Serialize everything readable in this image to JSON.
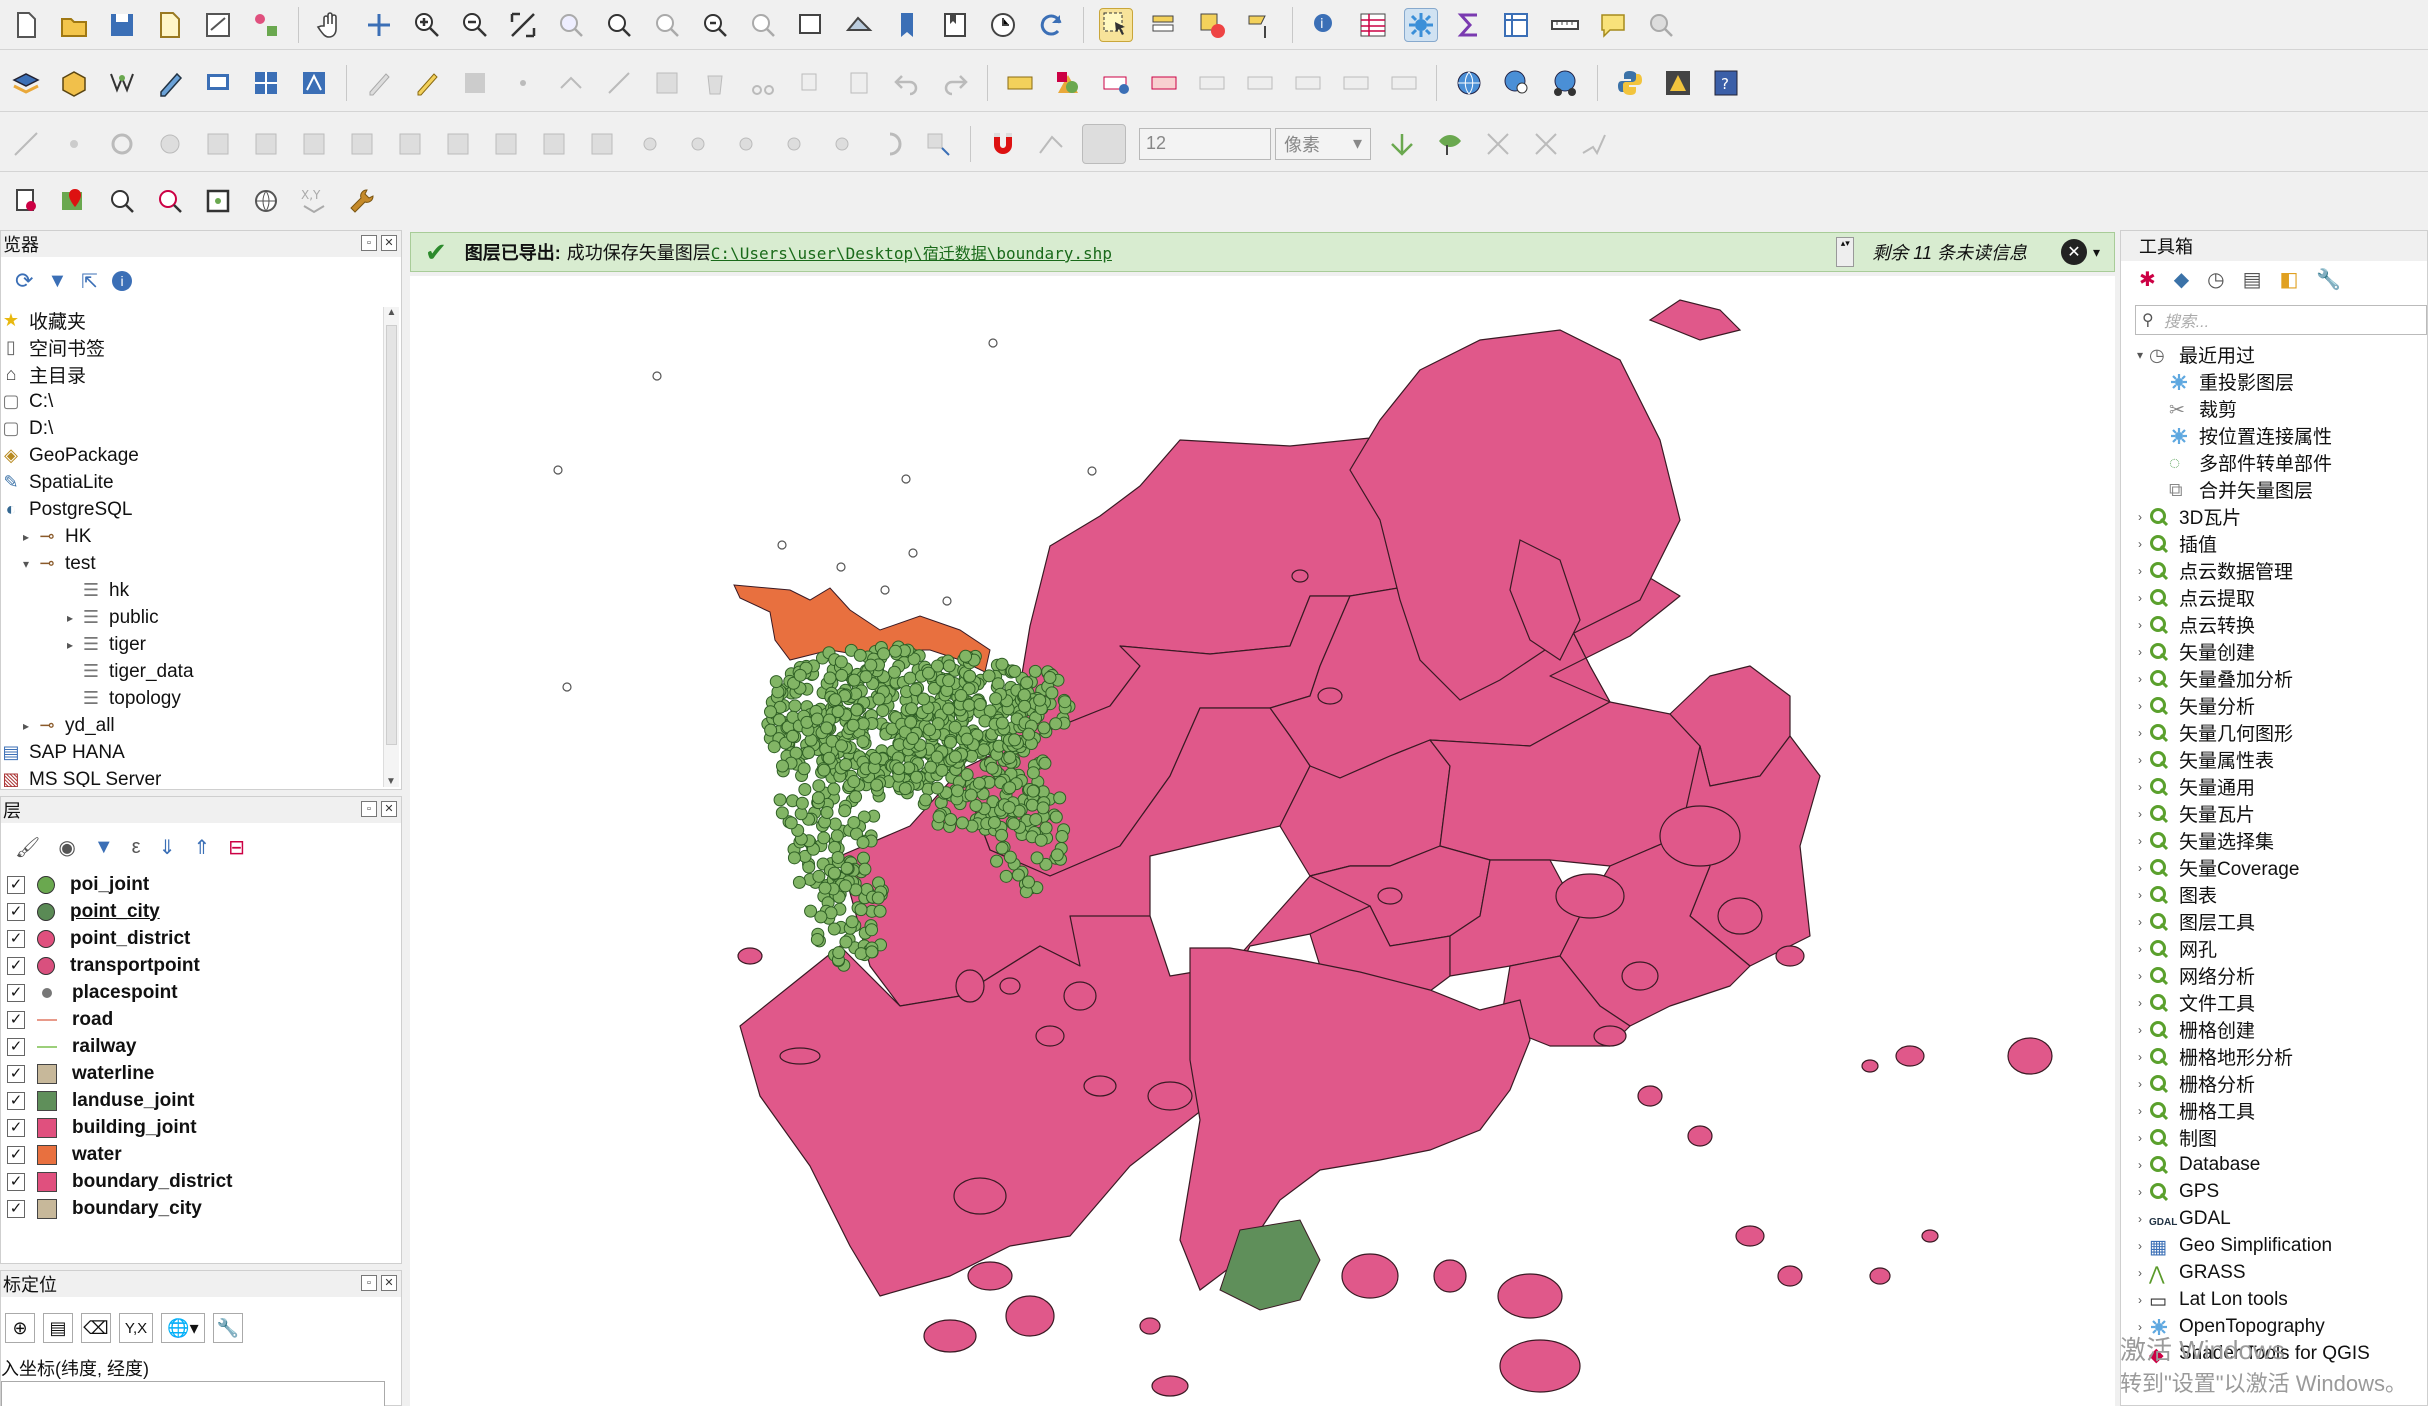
{
  "toolbars": {
    "font_size_value": "12",
    "unit_select": "像素"
  },
  "browser": {
    "title": "览器",
    "items": [
      {
        "label": "收藏夹",
        "icon": "star-icon",
        "indent": 0
      },
      {
        "label": "空间书签",
        "icon": "bookmark-icon",
        "indent": 0
      },
      {
        "label": "主目录",
        "icon": "home-folder-icon",
        "indent": 0
      },
      {
        "label": "C:\\",
        "icon": "folder-icon",
        "indent": 0
      },
      {
        "label": "D:\\",
        "icon": "folder-icon",
        "indent": 0
      },
      {
        "label": "GeoPackage",
        "icon": "geopackage-icon",
        "indent": 0
      },
      {
        "label": "SpatiaLite",
        "icon": "spatialite-icon",
        "indent": 0
      },
      {
        "label": "PostgreSQL",
        "icon": "postgresql-icon",
        "indent": 0
      },
      {
        "label": "HK",
        "icon": "connection-icon",
        "indent": 1,
        "expander": "▸"
      },
      {
        "label": "test",
        "icon": "connection-icon",
        "indent": 1,
        "expander": "▾"
      },
      {
        "label": "hk",
        "icon": "schema-icon",
        "indent": 3
      },
      {
        "label": "public",
        "icon": "schema-icon",
        "indent": 3,
        "expander": "▸"
      },
      {
        "label": "tiger",
        "icon": "schema-icon",
        "indent": 3,
        "expander": "▸"
      },
      {
        "label": "tiger_data",
        "icon": "schema-icon",
        "indent": 3
      },
      {
        "label": "topology",
        "icon": "schema-icon",
        "indent": 3
      },
      {
        "label": "yd_all",
        "icon": "connection-icon",
        "indent": 1,
        "expander": "▸"
      },
      {
        "label": "SAP HANA",
        "icon": "hana-icon",
        "indent": 0
      },
      {
        "label": "MS SQL Server",
        "icon": "mssql-icon",
        "indent": 0
      }
    ]
  },
  "layers": {
    "title": "层",
    "items": [
      {
        "label": "poi_joint",
        "symbol": "point",
        "color": "#6aa84f"
      },
      {
        "label": "point_city",
        "symbol": "point",
        "color": "#5a8a55",
        "underline": true
      },
      {
        "label": "point_district",
        "symbol": "point",
        "color": "#e0507e"
      },
      {
        "label": "transportpoint",
        "symbol": "point",
        "color": "#d9507e"
      },
      {
        "label": "placespoint",
        "symbol": "dot",
        "color": "#777777"
      },
      {
        "label": "road",
        "symbol": "line",
        "color": "#e89a8a"
      },
      {
        "label": "railway",
        "symbol": "line",
        "color": "#9ccf7a"
      },
      {
        "label": "waterline",
        "symbol": "fill",
        "color": "#c7b89a"
      },
      {
        "label": "landuse_joint",
        "symbol": "fill",
        "color": "#5f8f5a"
      },
      {
        "label": "building_joint",
        "symbol": "fill",
        "color": "#e0507e"
      },
      {
        "label": "water",
        "symbol": "fill",
        "color": "#e8703f"
      },
      {
        "label": "boundary_district",
        "symbol": "fill",
        "color": "#e0507e"
      },
      {
        "label": "boundary_city",
        "symbol": "fill",
        "color": "#c7b89a"
      }
    ]
  },
  "locator": {
    "title": "标定位",
    "yx_button": "Y,X",
    "prompt": "入坐标(纬度, 经度)"
  },
  "message_bar": {
    "title": "图层已导出:",
    "text": "成功保存矢量图层",
    "link": "C:\\Users\\user\\Desktop\\宿迁数据\\boundary.shp",
    "remaining": "剩余 11 条未读信息"
  },
  "toolbox": {
    "title": "工具箱",
    "search_placeholder": "搜索...",
    "recent_label": "最近用过",
    "recent": [
      {
        "label": "重投影图层",
        "icon": "gear-icon"
      },
      {
        "label": "裁剪",
        "icon": "clip-icon"
      },
      {
        "label": "按位置连接属性",
        "icon": "gear-icon"
      },
      {
        "label": "多部件转单部件",
        "icon": "multipart-icon"
      },
      {
        "label": "合并矢量图层",
        "icon": "merge-icon"
      }
    ],
    "groups": [
      "3D瓦片",
      "插值",
      "点云数据管理",
      "点云提取",
      "点云转换",
      "矢量创建",
      "矢量叠加分析",
      "矢量分析",
      "矢量几何图形",
      "矢量属性表",
      "矢量通用",
      "矢量瓦片",
      "矢量选择集",
      "矢量Coverage",
      "图表",
      "图层工具",
      "网孔",
      "网络分析",
      "文件工具",
      "栅格创建",
      "栅格地形分析",
      "栅格分析",
      "栅格工具",
      "制图",
      "Database",
      "GPS"
    ],
    "providers": [
      {
        "label": "GDAL",
        "icon": "gdal-icon"
      },
      {
        "label": "Geo Simplification",
        "icon": "geo-simplification-icon"
      },
      {
        "label": "GRASS",
        "icon": "grass-icon"
      },
      {
        "label": "Lat Lon tools",
        "icon": "latlon-icon"
      },
      {
        "label": "OpenTopography",
        "icon": "gear-icon"
      },
      {
        "label": "Shader Tools for QGIS",
        "icon": "shader-icon"
      }
    ]
  },
  "watermark": {
    "line1": "激活 Windows",
    "line2": "转到\"设置\"以激活 Windows。"
  },
  "colors": {
    "district": "#e0588a",
    "border": "#3a1a24",
    "water": "#e8703f",
    "poi": "#82b565",
    "poi_stroke": "#2f5f25",
    "msg_bg": "#d8ecd0"
  }
}
